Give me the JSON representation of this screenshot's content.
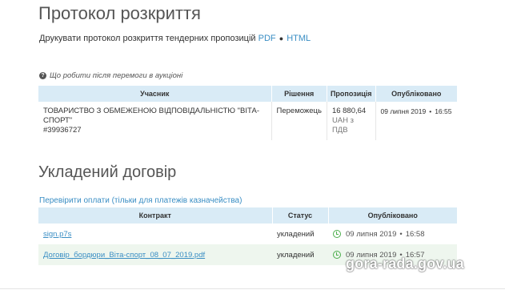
{
  "opening_protocol": {
    "title": "Протокол розкриття",
    "print_prefix": "Друкувати протокол розкриття тендерних пропозицій",
    "pdf_link": "PDF",
    "separator": "●",
    "html_link": "HTML"
  },
  "help": {
    "icon": "question-circle-icon",
    "text": "Що робити після перемоги в аукціоні"
  },
  "results_table": {
    "headers": [
      "Учасник",
      "Рішення",
      "Пропозиція",
      "Опубліковано"
    ],
    "row": {
      "participant_name": "ТОВАРИСТВО З ОБМЕЖЕНОЮ ВІДПОВІДАЛЬНІСТЮ \"ВІТА-СПОРТ\"",
      "participant_code": "#39936727",
      "decision": "Переможець",
      "amount": "16 880,64",
      "currency_line": "UAH з",
      "vat_line": "ПДВ",
      "pub_date": "09 липня 2019",
      "bullet": "•",
      "pub_time": "16:55"
    }
  },
  "contract": {
    "title": "Укладений договір",
    "check_link": "Перевірити оплати (тільки для платежів казначейства)",
    "headers": [
      "Контракт",
      "Статус",
      "Опубліковано"
    ],
    "rows": [
      {
        "name": "sign.p7s",
        "status": "укладений",
        "date": "09 липня 2019",
        "bullet": "•",
        "time": "16:58"
      },
      {
        "name": "Договір_бордюри_Віта-спорт_08_07_2019.pdf",
        "status": "укладений",
        "date": "09 липня 2019",
        "bullet": "•",
        "time": "16:57"
      }
    ],
    "clock_icon": "clock-icon"
  },
  "watermark": "gora-rada.gov.ua",
  "colors": {
    "link": "#3a8ec4",
    "header_bg": "#d9ebf6",
    "row_highlight": "#eef6ee",
    "clock": "#4cae4c"
  }
}
